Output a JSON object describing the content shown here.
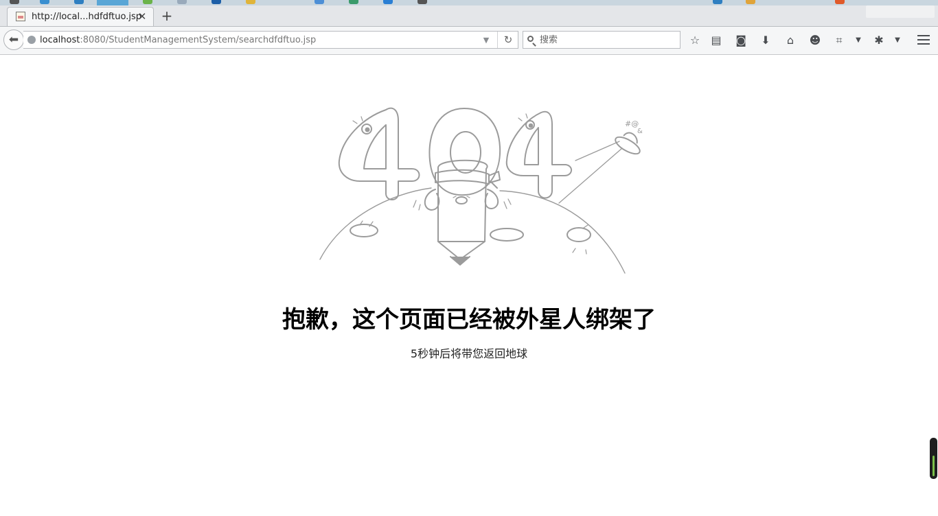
{
  "browser": {
    "tab_title": "http://local...hdfdftuo.jsp",
    "tab_close_glyph": "✕",
    "new_tab_glyph": "+",
    "url_host": "localhost",
    "url_rest": ":8080/StudentManagementSystem/searchdfdftuo.jsp",
    "search_placeholder": "搜索",
    "toolbar_icons": [
      "star-icon",
      "reading-list-icon",
      "pocket-icon",
      "download-icon",
      "home-icon",
      "chat-icon",
      "crop-icon",
      "extension-icon",
      "menu-icon"
    ]
  },
  "page": {
    "illustration_text": "404",
    "heading": "抱歉，这个页面已经被外星人绑架了",
    "subtext": "5秒钟后将带您返回地球"
  },
  "colors": {
    "illustration_stroke": "#9b9b9b",
    "scroll_accent": "#7cc14a"
  }
}
